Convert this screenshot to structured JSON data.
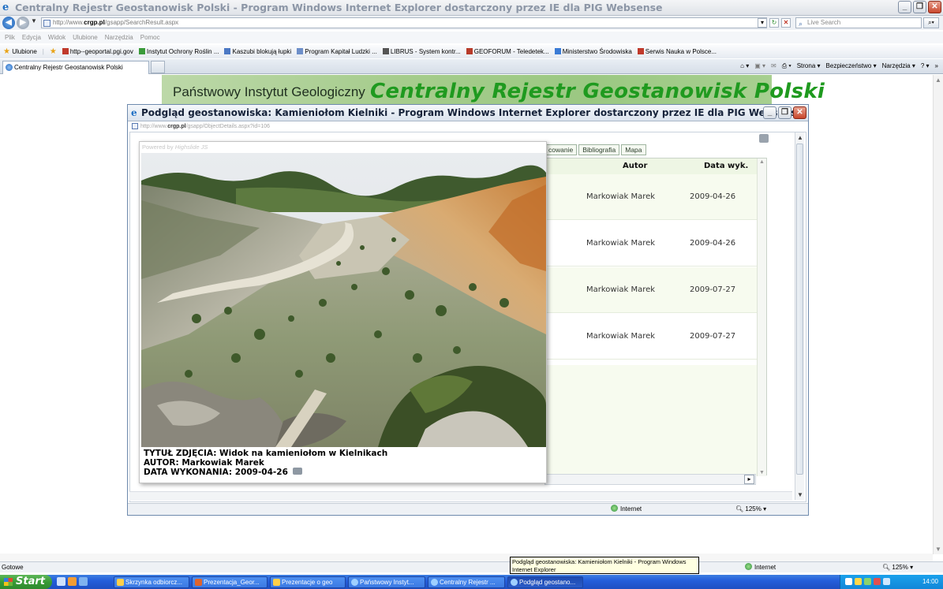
{
  "window": {
    "title": "Centralny Rejestr Geostanowisk Polski - Program Windows Internet Explorer dostarczony przez IE dla  PIG Websense"
  },
  "address": {
    "prefix": "http://www.",
    "domain": "crgp.pl",
    "path": "/gsapp/SearchResult.aspx",
    "search_placeholder": "Live Search"
  },
  "menu": [
    "Plik",
    "Edycja",
    "Widok",
    "Ulubione",
    "Narzędzia",
    "Pomoc"
  ],
  "favorites": {
    "label": "Ulubione",
    "items": [
      "http--geoportal.pgi.gov",
      "Instytut Ochrony Roślin ...",
      "Kaszubi blokują łupki",
      "Program Kapitał Ludzki ...",
      "LIBRUS - System kontr...",
      "GEOFORUM - Teledetek...",
      "Ministerstwo Środowiska",
      "Serwis Nauka w Polsce..."
    ]
  },
  "tab": {
    "label": "Centralny Rejestr Geostanowisk Polski"
  },
  "commandbar": {
    "strona": "Strona",
    "bezpieczenstwo": "Bezpieczeństwo",
    "narzedzia": "Narzędzia"
  },
  "banner": {
    "institute": "Państwowy Instytut Geologiczny",
    "registry": "Centralny Rejestr Geostanowisk Polski"
  },
  "popup": {
    "title": "Podgląd geostanowiska: Kamieniołom Kielniki - Program Windows Internet Explorer dostarczony przez IE dla  PIG Websense",
    "url_prefix": "http://www.",
    "url_domain": "crgp.pl",
    "url_path": "/gsapp/ObjectDetails.aspx?id=106",
    "tabs": [
      "cowanie",
      "Bibliografia",
      "Mapa"
    ],
    "table": {
      "headers": {
        "autor": "Autor",
        "data": "Data wyk."
      },
      "rows": [
        {
          "autor": "Markowiak Marek",
          "data": "2009-04-26"
        },
        {
          "autor": "Markowiak Marek",
          "data": "2009-04-26"
        },
        {
          "autor": "Markowiak Marek",
          "data": "2009-07-27"
        },
        {
          "autor": "Markowiak Marek",
          "data": "2009-07-27"
        }
      ]
    },
    "photo": {
      "powered_by": "Powered by",
      "powered_name": "Highslide JS",
      "title_line": "TYTUŁ ZDJĘCIA: Widok na kamieniołom w Kielnikach",
      "author_line": "AUTOR: Markowiak Marek",
      "date_line": "DATA WYKONANIA: 2009-04-26"
    },
    "status": {
      "zone": "Internet",
      "zoom": "125%"
    }
  },
  "status": {
    "ready": "Gotowe",
    "zone": "Internet",
    "zoom": "125%"
  },
  "tooltip": "Podgląd geostanowiska: Kamieniołom Kielniki - Program Windows Internet Explorer",
  "taskbar": {
    "start": "Start",
    "buttons": [
      "Skrzynka odbiorcz...",
      "Prezentacja_Geor...",
      "Prezentacje o geo",
      "Państwowy Instyt...",
      "Centralny Rejestr ...",
      "Podgląd geostano..."
    ],
    "clock": "14:00"
  },
  "colors": {
    "banner_green": "#a5cc8c",
    "registry_text": "#1f9a1f",
    "taskbar_blue": "#245edb",
    "start_green": "#389a36"
  }
}
